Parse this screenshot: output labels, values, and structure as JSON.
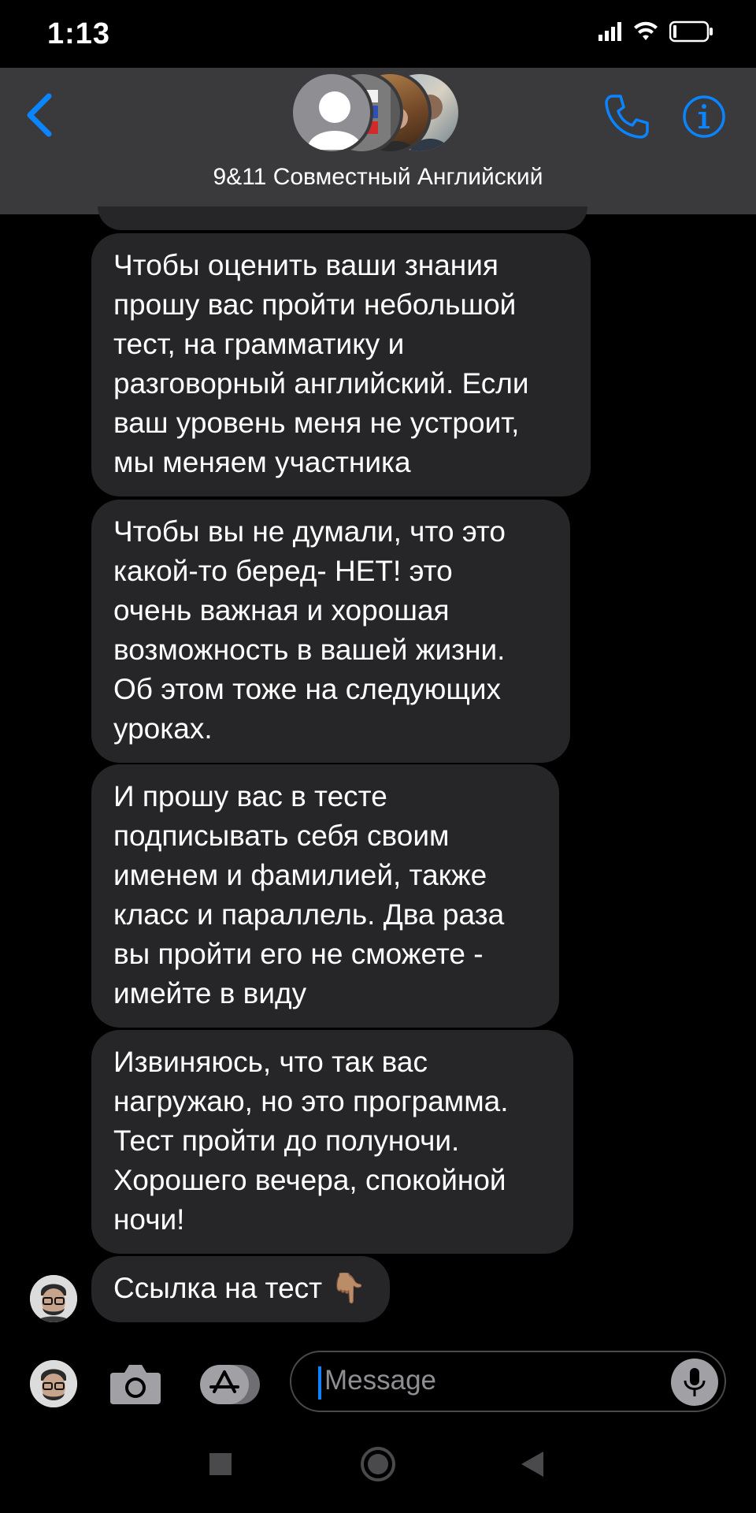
{
  "status_bar": {
    "time": "1:13"
  },
  "header": {
    "group_name": "9&11 Совместный Английский",
    "accent_color": "#0a84ff"
  },
  "messages": [
    {
      "text": "Чтобы оценить ваши знания\nпрошу вас пройти небольшой\nтест, на грамматику и\nразговорный английский. Если\nваш уровень меня не устроит,\nмы меняем участника"
    },
    {
      "text": "Чтобы вы не думали, что это\nкакой-то беред- НЕТ!  это\nочень важная и хорошая\nвозможность в вашей жизни.\nОб этом тоже на следующих\nуроках."
    },
    {
      "text": "И прошу вас в тесте\nподписывать себя своим\nименем и фамилией, также\nкласс и параллель. Два раза\nвы пройти его не сможете -\nимейте в виду"
    },
    {
      "text": "Извиняюсь, что так вас\nнагружаю, но это программа.\nТест пройти до полуночи.\nХорошего вечера, спокойной\nночи!"
    },
    {
      "text": "Ссылка на тест 👇🏽"
    }
  ],
  "composer": {
    "placeholder": "Message"
  },
  "icons": {
    "back": "chevron-left-icon",
    "phone": "phone-icon",
    "info": "info-icon",
    "camera": "camera-icon",
    "appstore": "app-store-icon",
    "mic": "microphone-icon",
    "nav_square": "recent-apps-icon",
    "nav_circle": "home-icon",
    "nav_triangle": "back-nav-icon"
  },
  "colors": {
    "bubble": "#262629",
    "header": "#3a3a3c",
    "background": "#000000"
  }
}
